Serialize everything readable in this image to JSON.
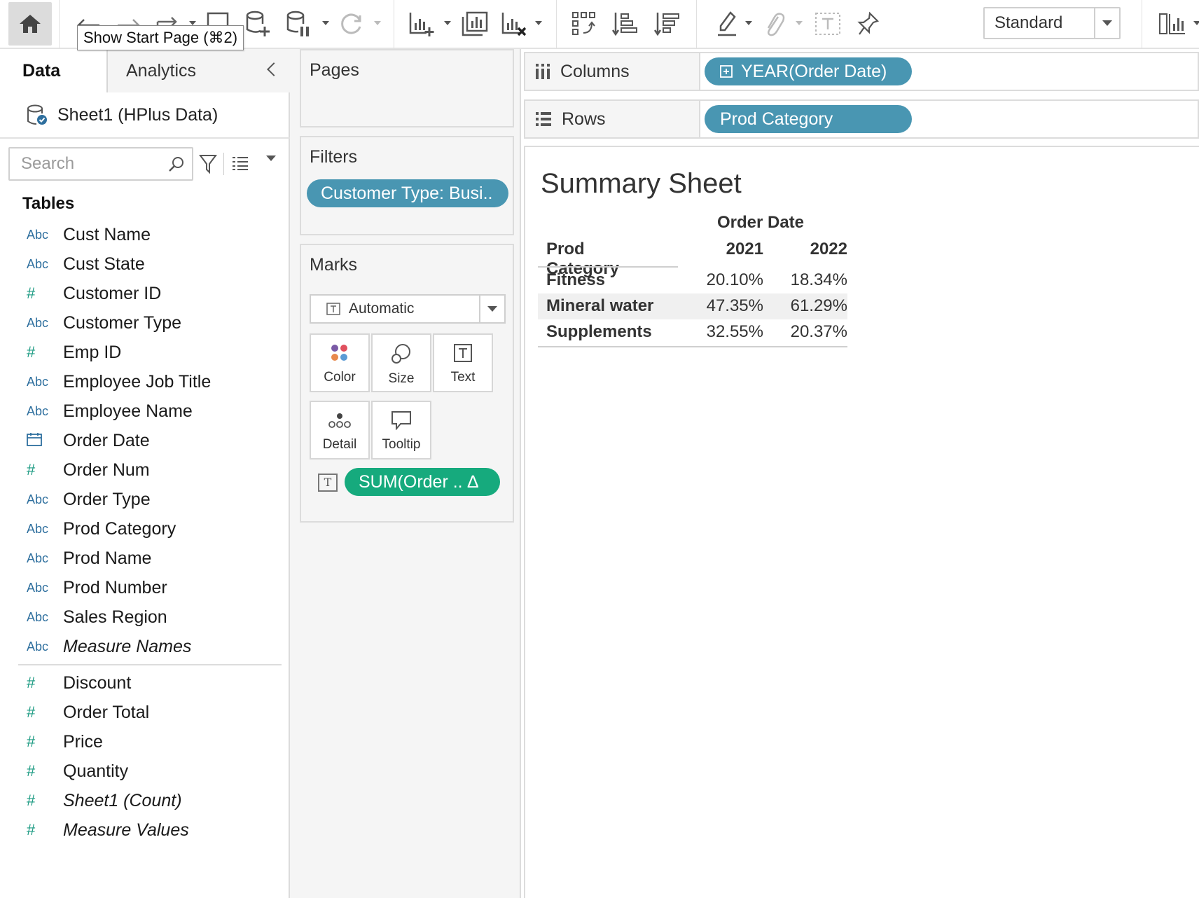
{
  "toolbar": {
    "tooltip": "Show Start Page (⌘2)",
    "fit_value": "Standard",
    "icons": [
      "home-icon",
      "undo-icon",
      "redo-icon",
      "swap-icon",
      "save-icon",
      "new-datasource-icon",
      "pause-updates-icon",
      "refresh-icon",
      "new-worksheet-icon",
      "duplicate-sheet-icon",
      "clear-sheet-icon",
      "swap-rows-columns-icon",
      "sort-ascending-icon",
      "sort-descending-icon",
      "highlight-icon",
      "group-icon",
      "labels-icon",
      "pin-icon",
      "show-cards-icon"
    ]
  },
  "left": {
    "tabs": {
      "data": "Data",
      "analytics": "Analytics"
    },
    "datasource": "Sheet1 (HPlus Data)",
    "search_placeholder": "Search",
    "tables_header": "Tables",
    "dimensions": [
      {
        "type": "Abc",
        "kind": "string",
        "name": "Cust Name"
      },
      {
        "type": "Abc",
        "kind": "string",
        "name": "Cust State"
      },
      {
        "type": "#",
        "kind": "number",
        "name": "Customer ID"
      },
      {
        "type": "Abc",
        "kind": "string",
        "name": "Customer Type"
      },
      {
        "type": "#",
        "kind": "number",
        "name": "Emp ID"
      },
      {
        "type": "Abc",
        "kind": "string",
        "name": "Employee Job Title"
      },
      {
        "type": "Abc",
        "kind": "string",
        "name": "Employee Name"
      },
      {
        "type": "",
        "kind": "date",
        "name": "Order Date"
      },
      {
        "type": "#",
        "kind": "number",
        "name": "Order Num"
      },
      {
        "type": "Abc",
        "kind": "string",
        "name": "Order Type"
      },
      {
        "type": "Abc",
        "kind": "string",
        "name": "Prod Category"
      },
      {
        "type": "Abc",
        "kind": "string",
        "name": "Prod Name"
      },
      {
        "type": "Abc",
        "kind": "string",
        "name": "Prod Number"
      },
      {
        "type": "Abc",
        "kind": "string",
        "name": "Sales Region"
      },
      {
        "type": "Abc",
        "kind": "string",
        "name": "Measure Names",
        "italic": true
      }
    ],
    "measures": [
      {
        "type": "#",
        "name": "Discount"
      },
      {
        "type": "#",
        "name": "Order Total"
      },
      {
        "type": "#",
        "name": "Price"
      },
      {
        "type": "#",
        "name": "Quantity"
      },
      {
        "type": "#",
        "name": "Sheet1 (Count)",
        "italic": true
      },
      {
        "type": "#",
        "name": "Measure Values",
        "italic": true
      }
    ]
  },
  "shelves": {
    "pages_label": "Pages",
    "filters_label": "Filters",
    "filter_pill": "Customer Type: Busi..",
    "marks_label": "Marks",
    "mark_type": "Automatic",
    "mark_buttons": {
      "color": "Color",
      "size": "Size",
      "text": "Text",
      "detail": "Detail",
      "tooltip": "Tooltip"
    },
    "text_pill": "SUM(Order .. ∆",
    "columns_label": "Columns",
    "columns_pill": "YEAR(Order Date)",
    "rows_label": "Rows",
    "rows_pill": "Prod Category"
  },
  "viz": {
    "title": "Summary Sheet",
    "column_group_header": "Order Date",
    "row_header": "Prod Category",
    "years": [
      "2021",
      "2022"
    ],
    "rows": [
      {
        "category": "Fitness",
        "values": [
          "20.10%",
          "18.34%"
        ]
      },
      {
        "category": "Mineral water",
        "values": [
          "47.35%",
          "61.29%"
        ]
      },
      {
        "category": "Supplements",
        "values": [
          "32.55%",
          "20.37%"
        ]
      }
    ]
  },
  "colors": {
    "pill_blue": "#4996b2",
    "pill_green": "#16aa7d",
    "dimension_icon": "#2e6f9e",
    "measure_icon": "#1b9a82"
  }
}
